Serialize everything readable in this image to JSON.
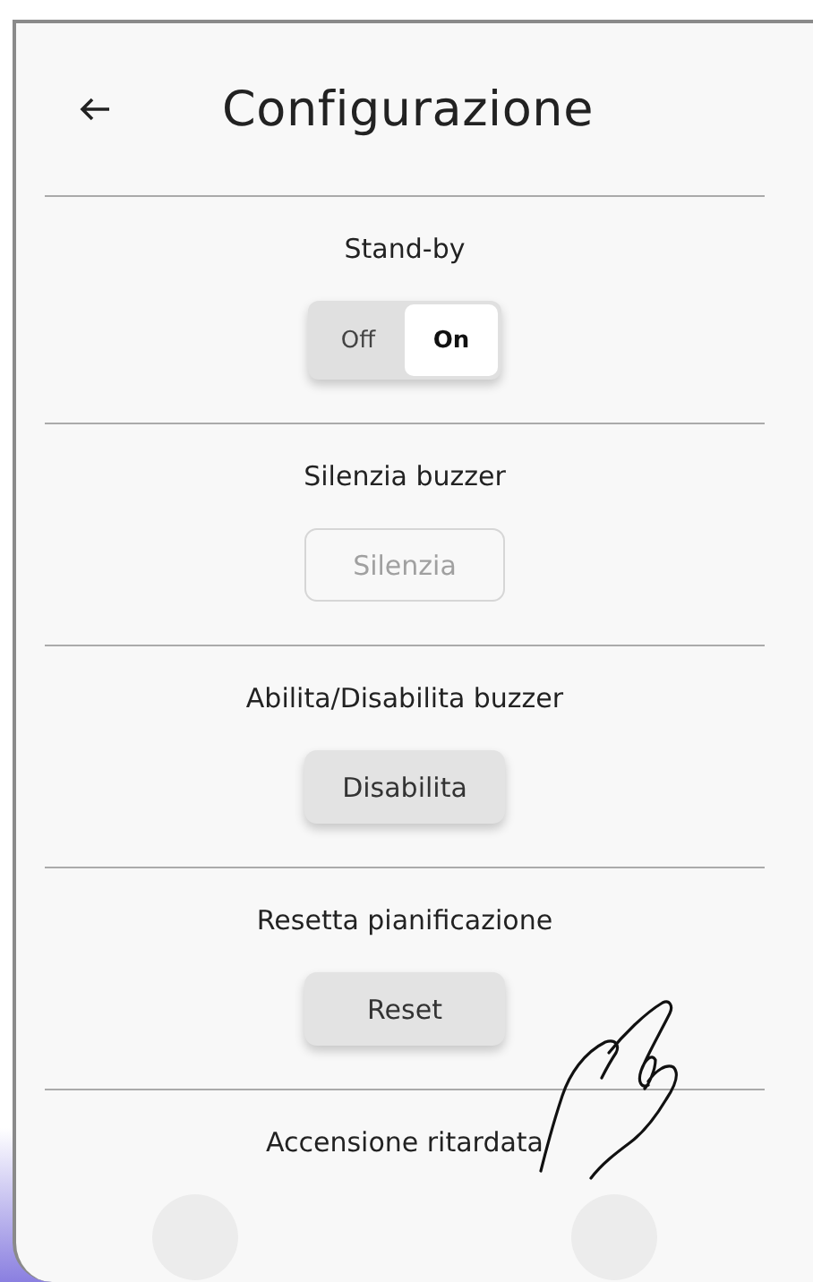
{
  "header": {
    "title": "Configurazione"
  },
  "sections": [
    {
      "title": "Stand-by",
      "kind": "toggle",
      "options": [
        {
          "label": "Off",
          "selected": false
        },
        {
          "label": "On",
          "selected": true
        }
      ]
    },
    {
      "title": "Silenzia buzzer",
      "kind": "button",
      "button": {
        "label": "Silenzia",
        "disabled": true
      }
    },
    {
      "title": "Abilita/Disabilita buzzer",
      "kind": "button",
      "button": {
        "label": "Disabilita",
        "disabled": false
      }
    },
    {
      "title": "Resetta pianificazione",
      "kind": "button",
      "button": {
        "label": "Reset",
        "disabled": false
      }
    },
    {
      "title": "Accensione ritardata",
      "kind": "heading"
    }
  ]
}
